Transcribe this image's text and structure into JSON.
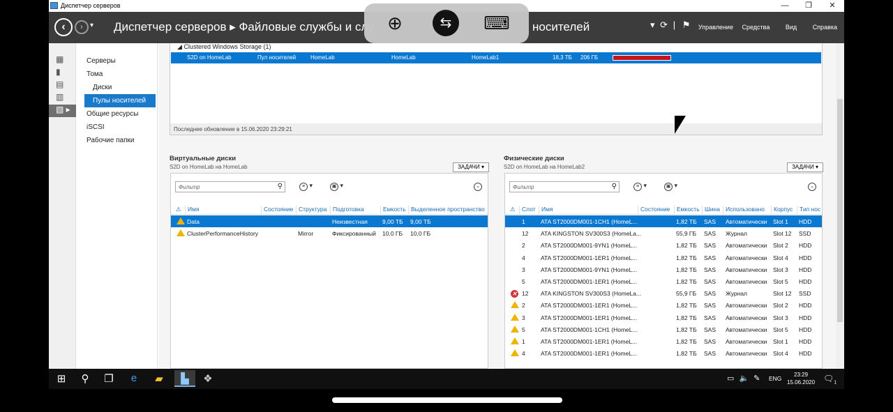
{
  "window": {
    "title": "Диспетчер серверов",
    "min": "—",
    "max": "❐",
    "close": "✕"
  },
  "header": {
    "back_icon": "back-arrow-icon",
    "breadcrumb": "Диспетчер серверов ▸ Файловые службы и слу",
    "breadcrumb_tail": "носителей",
    "menus": [
      "Управление",
      "Средства",
      "Вид",
      "Справка"
    ]
  },
  "rdp_toolbar": {
    "icons": [
      "zoom-in-icon",
      "remote-desktop-icon",
      "keyboard-icon"
    ]
  },
  "left_icons": [
    "dashboard-icon",
    "local-server-icon",
    "all-servers-icon",
    "file-services-icon",
    "storage-icon"
  ],
  "tree": [
    "Серверы",
    "Тома",
    "Диски",
    "Пулы носителей",
    "Общие ресурсы",
    "iSCSI",
    "Рабочие папки"
  ],
  "pools": {
    "group": "Clustered Windows Storage (1)",
    "row": {
      "name": "S2D on HomeLab",
      "type": "Пул носителей",
      "managed": "HomeLab",
      "available": "HomeLab",
      "node": "HomeLab1",
      "capacity": "18,3 ТБ",
      "free": "206 ГБ",
      "usage": 0.99
    },
    "last_update": "Последнее обновление в 15.06.2020 23:29:21"
  },
  "vdisks": {
    "title": "Виртуальные диски",
    "subtitle": "S2D on HomeLab на HomeLab",
    "tasks": "ЗАДАЧИ",
    "filter_placeholder": "Фильтр",
    "columns": [
      "Имя",
      "Состояние",
      "Структура",
      "Подготовка",
      "Емкость",
      "Выделенное пространство"
    ],
    "rows": [
      {
        "name": "Data",
        "layout": "",
        "prov": "Неизвестная",
        "cap": "9,00 ТБ",
        "alloc": "9,00 ТБ"
      },
      {
        "name": "ClusterPerformanceHistory",
        "layout": "Mirror",
        "prov": "Фиксированный",
        "cap": "10,0 ГБ",
        "alloc": "10,0 ГБ"
      }
    ]
  },
  "pdisks": {
    "title": "Физические диски",
    "subtitle": "S2D on HomeLab на HomeLab2",
    "tasks": "ЗАДАЧИ",
    "filter_placeholder": "Фильтр",
    "columns": [
      "Слот",
      "Имя",
      "Состояние",
      "Емкость",
      "Шина",
      "Использовано",
      "Корпус",
      "Тип нос"
    ],
    "rows": [
      {
        "status": "",
        "slot": "1",
        "name": "ATA ST2000DM001-1CH1 (HomeL...",
        "cap": "1,82 ТБ",
        "bus": "SAS",
        "use": "Автоматически",
        "encl": "Slot 1",
        "type": "HDD"
      },
      {
        "status": "",
        "slot": "12",
        "name": "ATA KINGSTON SV300S3 (HomeLa...",
        "cap": "55,9 ГБ",
        "bus": "SAS",
        "use": "Журнал",
        "encl": "Slot 12",
        "type": "SSD"
      },
      {
        "status": "",
        "slot": "2",
        "name": "ATA ST2000DM001-9YN1 (HomeL...",
        "cap": "1,82 ТБ",
        "bus": "SAS",
        "use": "Автоматически",
        "encl": "Slot 2",
        "type": "HDD"
      },
      {
        "status": "",
        "slot": "4",
        "name": "ATA ST2000DM001-1ER1 (HomeL...",
        "cap": "1,82 ТБ",
        "bus": "SAS",
        "use": "Автоматически",
        "encl": "Slot 4",
        "type": "HDD"
      },
      {
        "status": "",
        "slot": "3",
        "name": "ATA ST2000DM001-9YN1 (HomeL...",
        "cap": "1,82 ТБ",
        "bus": "SAS",
        "use": "Автоматически",
        "encl": "Slot 3",
        "type": "HDD"
      },
      {
        "status": "",
        "slot": "5",
        "name": "ATA ST2000DM001-1ER1 (HomeL...",
        "cap": "1,82 ТБ",
        "bus": "SAS",
        "use": "Автоматически",
        "encl": "Slot 5",
        "type": "HDD"
      },
      {
        "status": "error",
        "slot": "12",
        "name": "ATA KINGSTON SV300S3 (HomeLa...",
        "cap": "55,9 ГБ",
        "bus": "SAS",
        "use": "Журнал",
        "encl": "Slot 12",
        "type": "SSD"
      },
      {
        "status": "warn",
        "slot": "2",
        "name": "ATA ST2000DM001-1ER1 (HomeL...",
        "cap": "1,82 ТБ",
        "bus": "SAS",
        "use": "Автоматически",
        "encl": "Slot 2",
        "type": "HDD"
      },
      {
        "status": "warn",
        "slot": "3",
        "name": "ATA ST2000DM001-1ER1 (HomeL...",
        "cap": "1,82 ТБ",
        "bus": "SAS",
        "use": "Автоматически",
        "encl": "Slot 3",
        "type": "HDD"
      },
      {
        "status": "warn",
        "slot": "5",
        "name": "ATA ST2000DM001-1CH1 (HomeL...",
        "cap": "1,82 ТБ",
        "bus": "SAS",
        "use": "Автоматически",
        "encl": "Slot 5",
        "type": "HDD"
      },
      {
        "status": "warn",
        "slot": "1",
        "name": "ATA ST2000DM001-1ER1 (HomeL...",
        "cap": "1,82 ТБ",
        "bus": "SAS",
        "use": "Автоматически",
        "encl": "Slot 1",
        "type": "HDD"
      },
      {
        "status": "warn",
        "slot": "4",
        "name": "ATA ST2000DM001-1ER1 (HomeL...",
        "cap": "1,82 ТБ",
        "bus": "SAS",
        "use": "Автоматически",
        "encl": "Slot 4",
        "type": "HDD"
      }
    ]
  },
  "taskbar": {
    "lang": "ENG",
    "time": "23:29",
    "date": "15.06.2020",
    "notif_count": "1"
  },
  "colors": {
    "accent": "#0a78d0",
    "header": "#3c3c3c",
    "capacity_bar": "#c4131b"
  }
}
